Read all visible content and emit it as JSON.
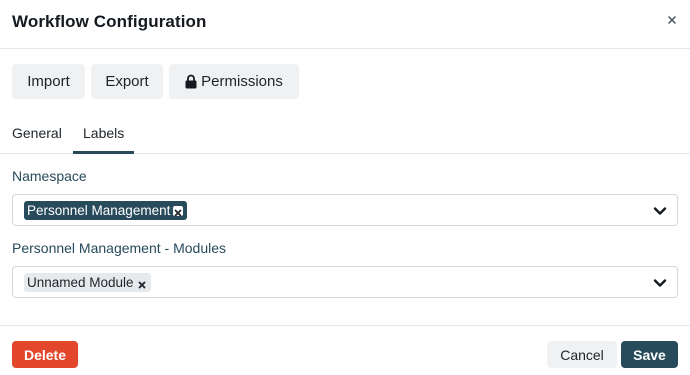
{
  "dialog": {
    "title": "Workflow Configuration",
    "close_icon": "close-icon"
  },
  "toolbar": {
    "import_label": "Import",
    "export_label": "Export",
    "permissions_label": "Permissions",
    "permissions_icon": "lock-icon"
  },
  "tabs": [
    {
      "label": "General",
      "active": false
    },
    {
      "label": "Labels",
      "active": true
    }
  ],
  "fields": {
    "namespace": {
      "label": "Namespace",
      "selected": [
        "Personnel Management"
      ]
    },
    "modules": {
      "label": "Personnel Management - Modules",
      "selected": [
        "Unnamed Module"
      ]
    }
  },
  "footer": {
    "delete_label": "Delete",
    "cancel_label": "Cancel",
    "save_label": "Save"
  },
  "colors": {
    "primary": "#284b5c",
    "danger": "#e2472c",
    "neutral_button": "#eff1f3"
  }
}
